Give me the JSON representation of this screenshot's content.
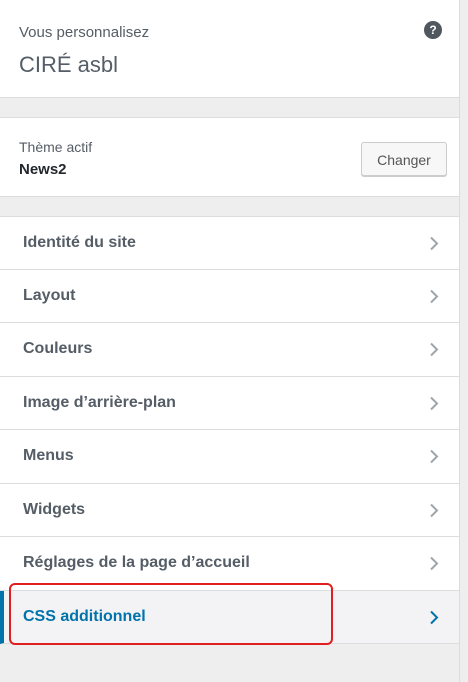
{
  "header": {
    "subtitle": "Vous personnalisez",
    "site_title": "CIRÉ asbl",
    "help_icon": "help-icon",
    "help_glyph": "?"
  },
  "theme": {
    "label": "Thème actif",
    "name": "News2",
    "change_label": "Changer"
  },
  "menu": {
    "chevron_icon": "chevron-right-icon",
    "items": [
      {
        "label": "Identité du site"
      },
      {
        "label": "Layout"
      },
      {
        "label": "Couleurs"
      },
      {
        "label": "Image d’arrière-plan"
      },
      {
        "label": "Menus"
      },
      {
        "label": "Widgets"
      },
      {
        "label": "Réglages de la page d’accueil"
      },
      {
        "label": "CSS additionnel",
        "active": true
      }
    ]
  },
  "colors": {
    "accent": "#0073aa",
    "highlight_border": "#e02020",
    "panel_bg": "#eeeeee"
  }
}
